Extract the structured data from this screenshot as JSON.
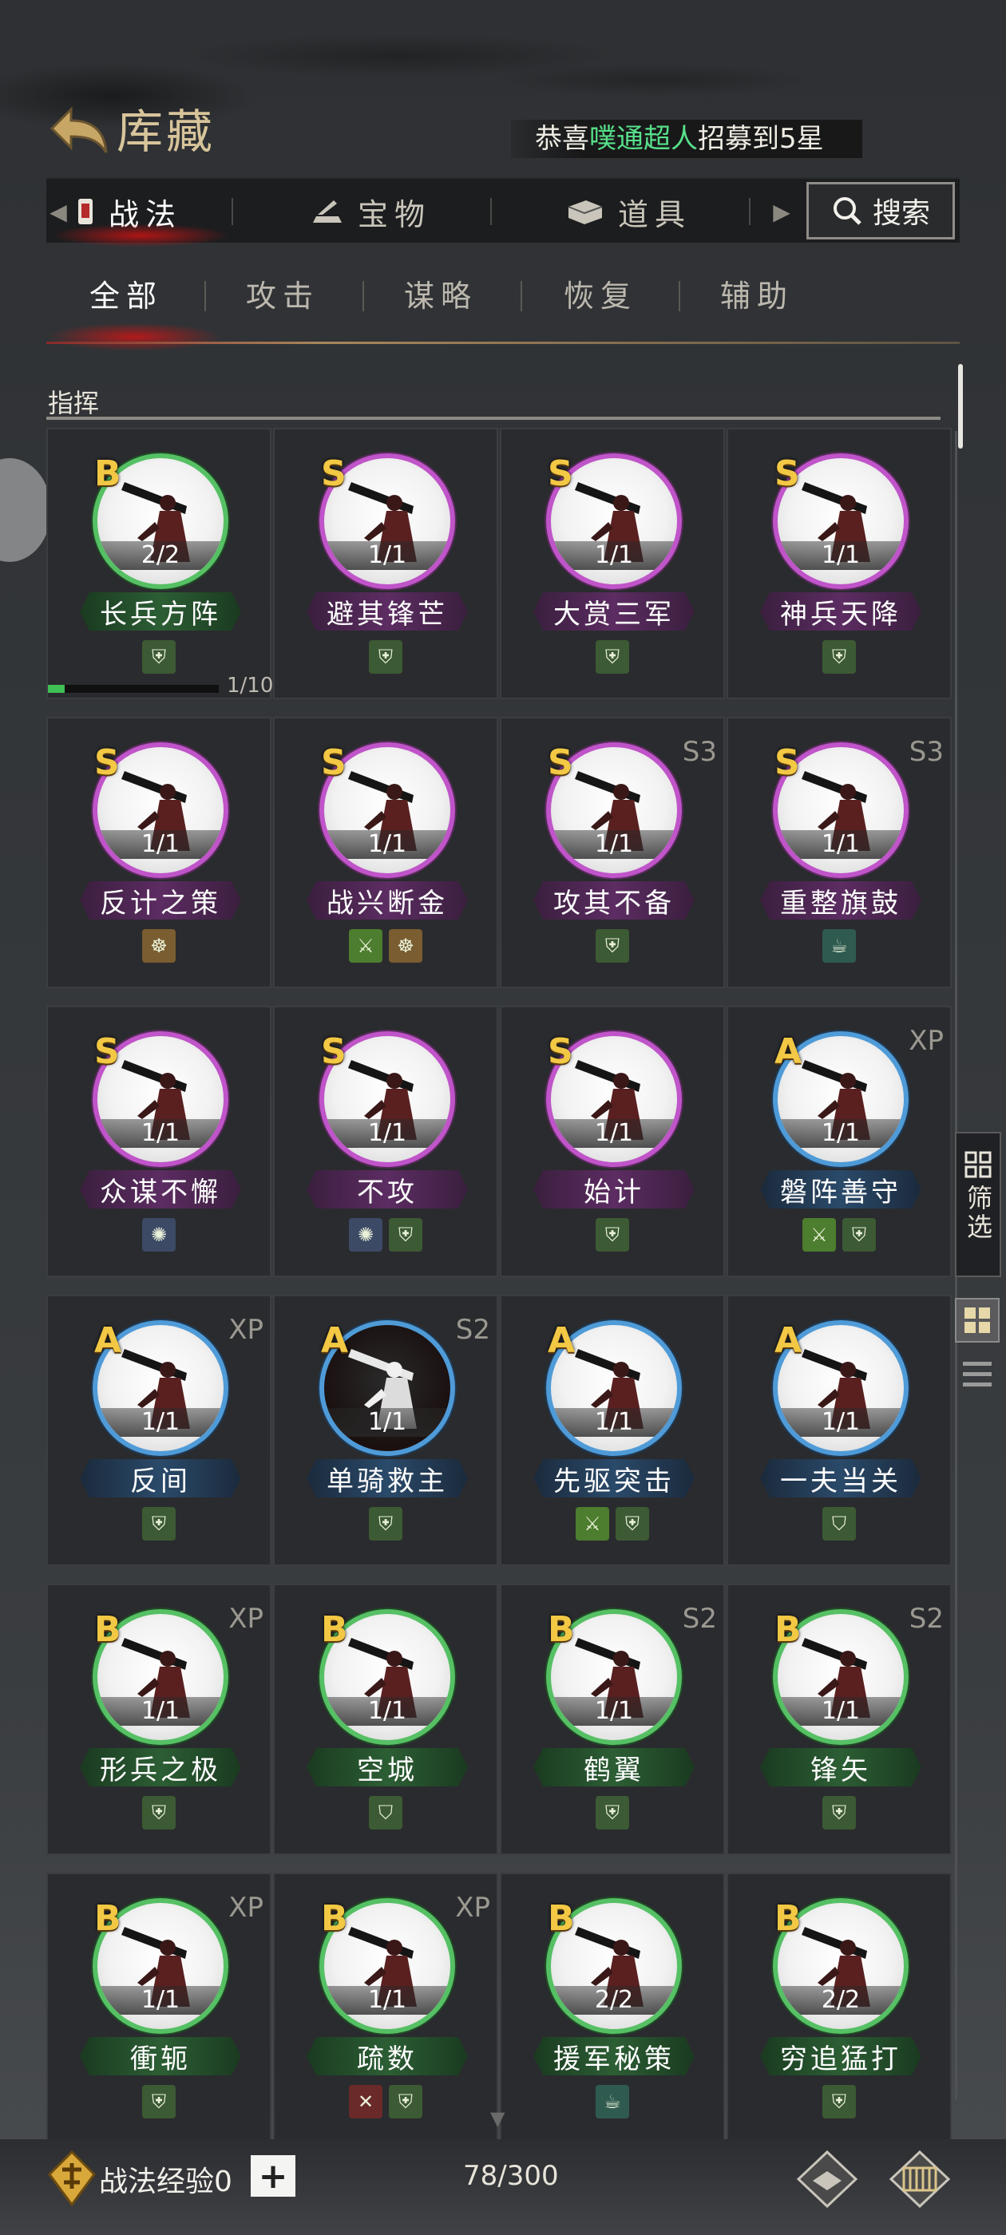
{
  "header": {
    "title": "库藏",
    "announcement": {
      "prefix": "恭喜",
      "player": "噗通超人",
      "suffix": "招募到5星"
    }
  },
  "category_tabs": [
    {
      "label": "战法",
      "icon": "scroll-icon",
      "active": true
    },
    {
      "label": "宝物",
      "icon": "treasure-icon",
      "active": false
    },
    {
      "label": "道具",
      "icon": "item-box-icon",
      "active": false
    }
  ],
  "search": {
    "label": "搜索"
  },
  "sub_tabs": [
    {
      "label": "全部",
      "active": true
    },
    {
      "label": "攻击",
      "active": false
    },
    {
      "label": "谋略",
      "active": false
    },
    {
      "label": "恢复",
      "active": false
    },
    {
      "label": "辅助",
      "active": false
    }
  ],
  "section": {
    "label": "指挥"
  },
  "cards": [
    {
      "grade": "B",
      "name": "长兵方阵",
      "count": "2/2",
      "tag": "",
      "icons": [
        {
          "name": "troop-icon",
          "color": "green"
        }
      ],
      "progress": {
        "text": "1/10",
        "value": 0.1
      }
    },
    {
      "grade": "S",
      "name": "避其锋芒",
      "count": "1/1",
      "tag": "",
      "icons": [
        {
          "name": "troop-icon",
          "color": "green"
        }
      ]
    },
    {
      "grade": "S",
      "name": "大赏三军",
      "count": "1/1",
      "tag": "",
      "icons": [
        {
          "name": "troop-icon",
          "color": "green"
        }
      ]
    },
    {
      "grade": "S",
      "name": "神兵天降",
      "count": "1/1",
      "tag": "",
      "icons": [
        {
          "name": "troop-icon",
          "color": "green"
        }
      ]
    },
    {
      "grade": "S",
      "name": "反计之策",
      "count": "1/1",
      "tag": "",
      "icons": [
        {
          "name": "helmet-icon",
          "color": "gold"
        }
      ]
    },
    {
      "grade": "S",
      "name": "战兴断金",
      "count": "1/1",
      "tag": "",
      "icons": [
        {
          "name": "sword-icon",
          "color": "bright"
        },
        {
          "name": "helmet-icon",
          "color": "gold"
        }
      ]
    },
    {
      "grade": "S",
      "name": "攻其不备",
      "count": "1/1",
      "tag": "S3",
      "icons": [
        {
          "name": "troop-icon",
          "color": "green"
        }
      ]
    },
    {
      "grade": "S",
      "name": "重整旗鼓",
      "count": "1/1",
      "tag": "S3",
      "icons": [
        {
          "name": "teapot-icon",
          "color": "teal"
        }
      ]
    },
    {
      "grade": "S",
      "name": "众谋不懈",
      "count": "1/1",
      "tag": "",
      "icons": [
        {
          "name": "brain-icon",
          "color": "blue"
        }
      ]
    },
    {
      "grade": "S",
      "name": "不攻",
      "count": "1/1",
      "tag": "",
      "icons": [
        {
          "name": "brain-icon",
          "color": "blue"
        },
        {
          "name": "troop-icon",
          "color": "green"
        }
      ]
    },
    {
      "grade": "S",
      "name": "始计",
      "count": "1/1",
      "tag": "",
      "icons": [
        {
          "name": "troop-icon",
          "color": "green"
        }
      ]
    },
    {
      "grade": "A",
      "name": "磐阵善守",
      "count": "1/1",
      "tag": "XP",
      "icons": [
        {
          "name": "sword-icon",
          "color": "bright"
        },
        {
          "name": "troop-icon",
          "color": "green"
        }
      ]
    },
    {
      "grade": "A",
      "name": "反间",
      "count": "1/1",
      "tag": "XP",
      "icons": [
        {
          "name": "troop-icon",
          "color": "green"
        }
      ]
    },
    {
      "grade": "A",
      "name": "单骑救主",
      "count": "1/1",
      "tag": "S2",
      "icons": [
        {
          "name": "troop-icon",
          "color": "green"
        }
      ],
      "dark": true
    },
    {
      "grade": "A",
      "name": "先驱突击",
      "count": "1/1",
      "tag": "",
      "icons": [
        {
          "name": "sword-icon",
          "color": "bright"
        },
        {
          "name": "troop-icon",
          "color": "green"
        }
      ]
    },
    {
      "grade": "A",
      "name": "一夫当关",
      "count": "1/1",
      "tag": "",
      "icons": [
        {
          "name": "shield-icon",
          "color": "green"
        }
      ]
    },
    {
      "grade": "B",
      "name": "形兵之极",
      "count": "1/1",
      "tag": "XP",
      "icons": [
        {
          "name": "troop-icon",
          "color": "green"
        }
      ]
    },
    {
      "grade": "B",
      "name": "空城",
      "count": "1/1",
      "tag": "",
      "icons": [
        {
          "name": "shield-icon",
          "color": "green"
        }
      ]
    },
    {
      "grade": "B",
      "name": "鹤翼",
      "count": "1/1",
      "tag": "S2",
      "icons": [
        {
          "name": "troop-icon",
          "color": "green"
        }
      ]
    },
    {
      "grade": "B",
      "name": "锋矢",
      "count": "1/1",
      "tag": "S2",
      "icons": [
        {
          "name": "troop-icon",
          "color": "green"
        }
      ]
    },
    {
      "grade": "B",
      "name": "衝轭",
      "count": "1/1",
      "tag": "XP",
      "icons": [
        {
          "name": "troop-icon",
          "color": "green"
        }
      ]
    },
    {
      "grade": "B",
      "name": "疏数",
      "count": "1/1",
      "tag": "XP",
      "icons": [
        {
          "name": "crossed-swords-icon",
          "color": "red"
        },
        {
          "name": "troop-icon",
          "color": "green"
        }
      ]
    },
    {
      "grade": "B",
      "name": "援军秘策",
      "count": "2/2",
      "tag": "",
      "icons": [
        {
          "name": "teapot-icon",
          "color": "teal"
        }
      ]
    },
    {
      "grade": "B",
      "name": "穷追猛打",
      "count": "2/2",
      "tag": "",
      "icons": [
        {
          "name": "troop-icon",
          "color": "green"
        }
      ]
    }
  ],
  "filter": {
    "label": "筛选"
  },
  "footer": {
    "exp_label": "战法经验0",
    "capacity": "78/300"
  },
  "colors": {
    "grade_S": "#c054c9",
    "grade_A": "#4f9bd8",
    "grade_B": "#56c064",
    "grade_text": "#f2c844"
  }
}
